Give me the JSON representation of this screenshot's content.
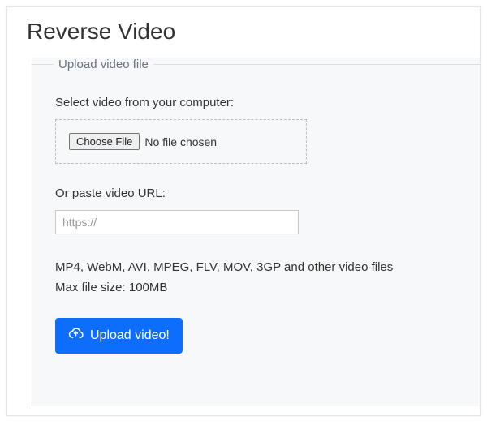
{
  "page": {
    "title": "Reverse Video"
  },
  "upload": {
    "group_label": "Upload video file",
    "select_label": "Select video from your computer:",
    "choose_file_label": "Choose File",
    "file_status": "No file chosen",
    "url_label": "Or paste video URL:",
    "url_placeholder": "https://",
    "url_value": "",
    "formats_text": "MP4, WebM, AVI, MPEG, FLV, MOV, 3GP and other video files",
    "max_size_text": "Max file size: 100MB",
    "submit_label": "Upload video!"
  }
}
